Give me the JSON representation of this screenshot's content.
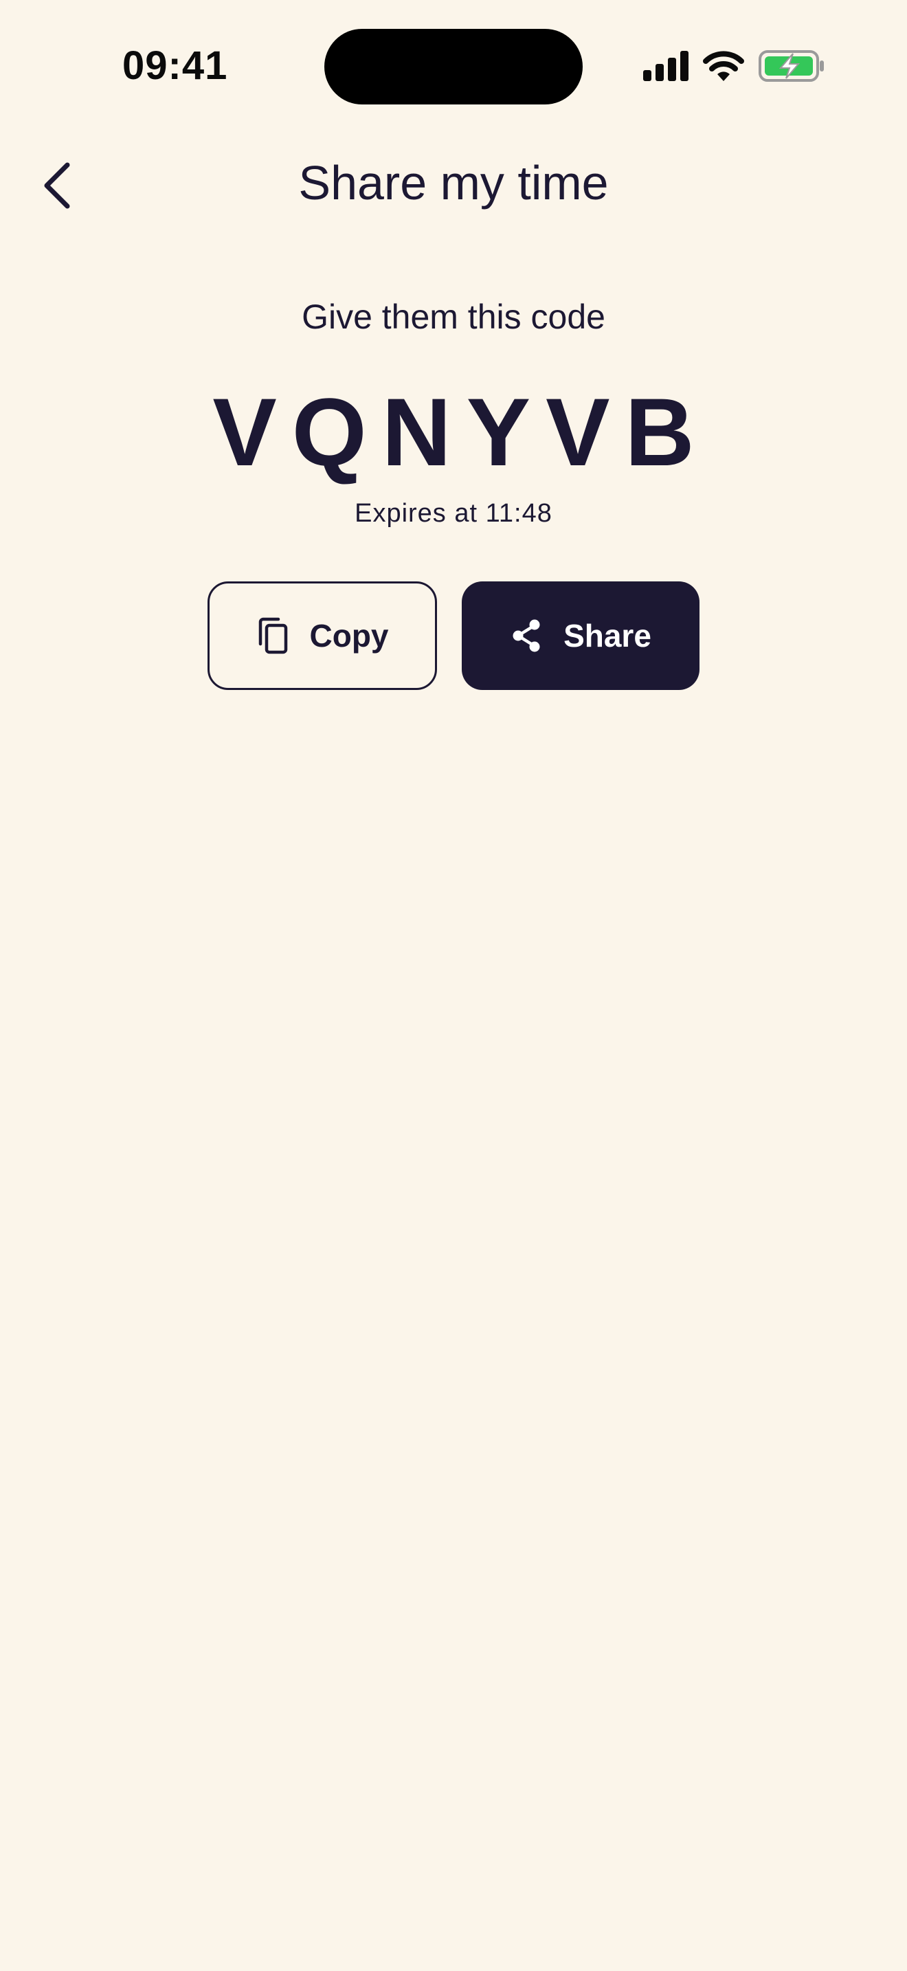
{
  "status_bar": {
    "time": "09:41"
  },
  "header": {
    "title": "Share my time"
  },
  "content": {
    "heading": "Give them this code",
    "code": "VQNYVB",
    "expiry": "Expires at 11:48"
  },
  "actions": {
    "copy_label": "Copy",
    "share_label": "Share"
  },
  "icons": {
    "back": "chevron-left-icon",
    "copy": "copy-icon",
    "share": "share-icon",
    "signal": "cellular-signal-icon",
    "wifi": "wifi-icon",
    "battery": "battery-charging-icon"
  },
  "colors": {
    "background": "#FBF5EA",
    "primary": "#1C1833",
    "battery": "#34C759"
  }
}
